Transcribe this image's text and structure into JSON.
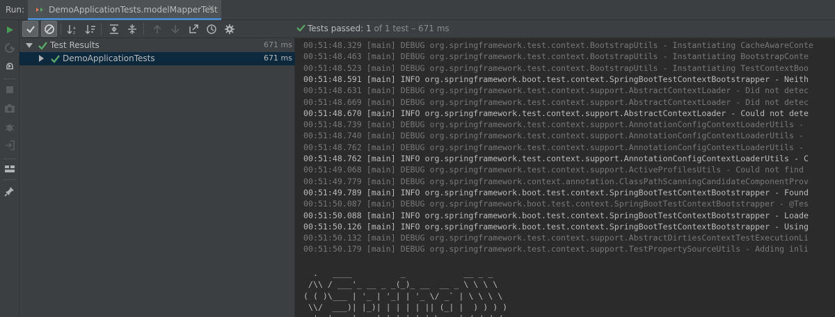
{
  "run_bar": {
    "label": "Run:",
    "tab_title": "DemoApplicationTests.modelMapperTest",
    "close_glyph": "✕"
  },
  "left_toolbar": {
    "icons": [
      "rerun-icon",
      "rerun-failed-icon",
      "toggle-auto-test-icon",
      "stop-icon",
      "screenshot-icon",
      "debug-icon",
      "exit-icon",
      "layout-icon",
      "pin-icon"
    ]
  },
  "test_toolbar": {
    "icons": [
      "show-passed-icon",
      "show-ignored-icon",
      "sort-alpha-icon",
      "sort-duration-icon",
      "expand-all-icon",
      "collapse-all-icon",
      "previous-failed-icon",
      "next-failed-icon",
      "export-icon",
      "history-icon",
      "settings-icon"
    ],
    "status_prefix": "Tests passed:",
    "status_count": "1",
    "status_suffix": "of 1 test – 671 ms"
  },
  "tree": {
    "root": {
      "name": "Test Results",
      "time": "671 ms"
    },
    "child": {
      "name": "DemoApplicationTests",
      "time": "671 ms"
    }
  },
  "console": {
    "lines": [
      {
        "level": "debug",
        "text": "00:51:48.329 [main] DEBUG org.springframework.test.context.BootstrapUtils - Instantiating CacheAwareConte"
      },
      {
        "level": "debug",
        "text": "00:51:48.463 [main] DEBUG org.springframework.test.context.BootstrapUtils - Instantiating BootstrapConte"
      },
      {
        "level": "debug",
        "text": "00:51:48.523 [main] DEBUG org.springframework.test.context.BootstrapUtils - Instantiating TestContextBoo"
      },
      {
        "level": "info",
        "text": "00:51:48.591 [main] INFO org.springframework.boot.test.context.SpringBootTestContextBootstrapper - Neith"
      },
      {
        "level": "debug",
        "text": "00:51:48.631 [main] DEBUG org.springframework.test.context.support.AbstractContextLoader - Did not detec"
      },
      {
        "level": "debug",
        "text": "00:51:48.669 [main] DEBUG org.springframework.test.context.support.AbstractContextLoader - Did not detec"
      },
      {
        "level": "info",
        "text": "00:51:48.670 [main] INFO org.springframework.test.context.support.AbstractContextLoader - Could not dete"
      },
      {
        "level": "debug",
        "text": "00:51:48.739 [main] DEBUG org.springframework.test.context.support.AnnotationConfigContextLoaderUtils - "
      },
      {
        "level": "debug",
        "text": "00:51:48.740 [main] DEBUG org.springframework.test.context.support.AnnotationConfigContextLoaderUtils - "
      },
      {
        "level": "debug",
        "text": "00:51:48.762 [main] DEBUG org.springframework.test.context.support.AnnotationConfigContextLoaderUtils - "
      },
      {
        "level": "info",
        "text": "00:51:48.762 [main] INFO org.springframework.test.context.support.AnnotationConfigContextLoaderUtils - C"
      },
      {
        "level": "debug",
        "text": "00:51:49.068 [main] DEBUG org.springframework.test.context.support.ActiveProfilesUtils - Could not find "
      },
      {
        "level": "debug",
        "text": "00:51:49.779 [main] DEBUG org.springframework.context.annotation.ClassPathScanningCandidateComponentProv"
      },
      {
        "level": "info",
        "text": "00:51:49.789 [main] INFO org.springframework.boot.test.context.SpringBootTestContextBootstrapper - Found"
      },
      {
        "level": "debug",
        "text": "00:51:50.087 [main] DEBUG org.springframework.boot.test.context.SpringBootTestContextBootstrapper - @Tes"
      },
      {
        "level": "info",
        "text": "00:51:50.088 [main] INFO org.springframework.boot.test.context.SpringBootTestContextBootstrapper - Loade"
      },
      {
        "level": "info",
        "text": "00:51:50.126 [main] INFO org.springframework.boot.test.context.SpringBootTestContextBootstrapper - Using"
      },
      {
        "level": "debug",
        "text": "00:51:50.132 [main] DEBUG org.springframework.test.context.support.AbstractDirtiesContextTestExecutionLi"
      },
      {
        "level": "debug",
        "text": "00:51:50.179 [main] DEBUG org.springframework.test.context.support.TestPropertySourceUtils - Adding inli"
      }
    ],
    "banner": "  .   ____          _            __ _ _\n /\\\\ / ___'_ __ _ _(_)_ __  __ _ \\ \\ \\ \\\n( ( )\\___ | '_ | '_| | '_ \\/ _` | \\ \\ \\ \\\n \\\\/  ___)| |_)| | | | | || (_| |  ) ) ) )\n  '  |____| .__|_| |_|_| |_\\__, | / / / /"
  },
  "colors": {
    "pass_green": "#59a869",
    "run_green": "#499c54",
    "selection": "#0d293e",
    "accent_blue": "#4a88c7"
  }
}
